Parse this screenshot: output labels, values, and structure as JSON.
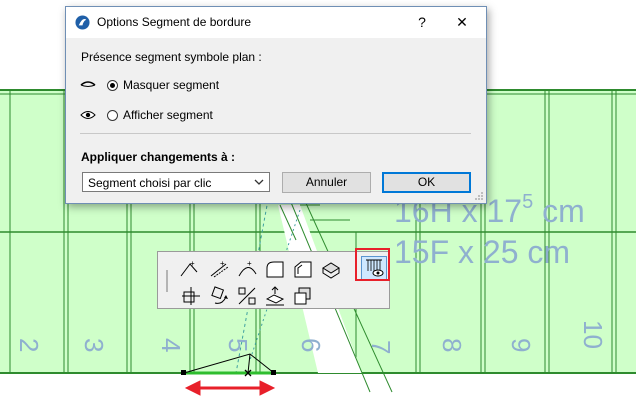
{
  "dialog": {
    "title": "Options Segment de bordure",
    "help_label": "?",
    "close_label": "✕",
    "section_heading": "Présence segment symbole plan :",
    "option_hide": "Masquer segment",
    "option_show": "Afficher segment",
    "selected_option": "Masquer segment",
    "apply_heading": "Appliquer changements à :",
    "apply_select_value": "Segment choisi par clic",
    "cancel_label": "Annuler",
    "ok_label": "OK"
  },
  "drawing": {
    "stair_label_1": "16H x 17",
    "stair_label_1_sup": "5",
    "stair_label_1_unit": " cm",
    "stair_label_2": "15F x 25 cm",
    "step_numbers": [
      "2",
      "3",
      "4",
      "5",
      "6",
      "7",
      "8",
      "9",
      "10"
    ]
  },
  "palette": {
    "tools": [
      "add-node-icon",
      "offset-edge-icon",
      "curve-edge-icon",
      "fillet-icon",
      "chamfer-icon",
      "solid-edit-icon",
      "move-node-icon",
      "rotate-icon",
      "split-icon",
      "elevate-icon",
      "copy-icon",
      "segment-visibility-icon"
    ]
  },
  "colors": {
    "stair_fill": "#cfffc9",
    "stair_line": "#2e8b2e",
    "label_blue": "#8fb0cf",
    "highlight": "#e8202a",
    "arrow_red": "#e8202a",
    "ok_border": "#0078d7"
  }
}
